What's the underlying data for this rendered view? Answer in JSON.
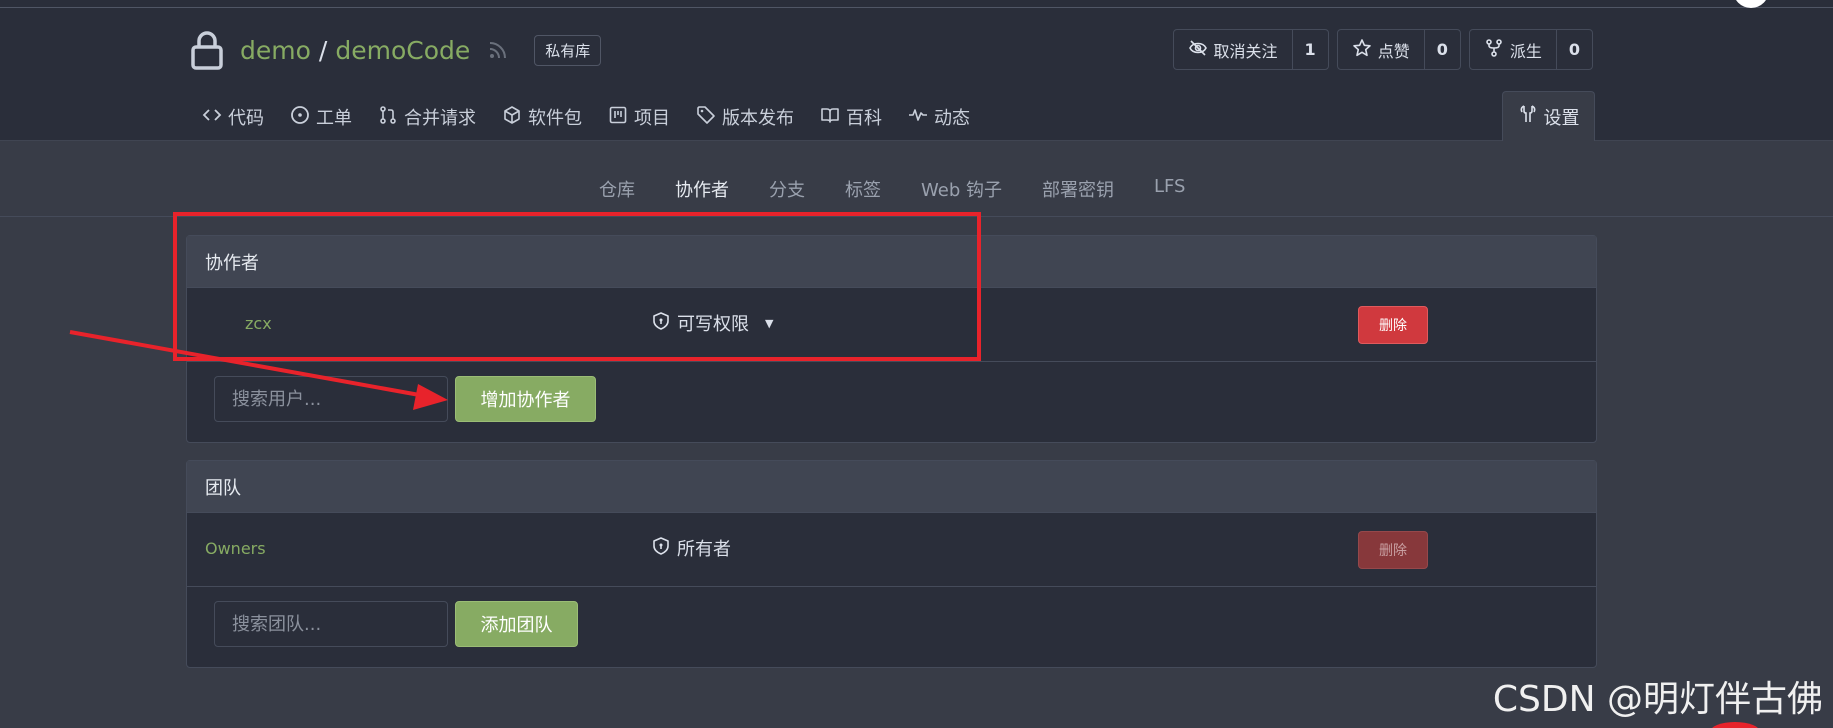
{
  "repo": {
    "owner": "demo",
    "separator": "/",
    "name": "demoCode",
    "badge": "私有库"
  },
  "buttons": {
    "watch": {
      "label": "取消关注",
      "count": "1"
    },
    "star": {
      "label": "点赞",
      "count": "0"
    },
    "fork": {
      "label": "派生",
      "count": "0"
    }
  },
  "tabs": [
    {
      "label": "代码",
      "icon": "code-icon"
    },
    {
      "label": "工单",
      "icon": "issue-icon"
    },
    {
      "label": "合并请求",
      "icon": "pull-request-icon"
    },
    {
      "label": "软件包",
      "icon": "package-icon"
    },
    {
      "label": "项目",
      "icon": "project-icon"
    },
    {
      "label": "版本发布",
      "icon": "tag-icon"
    },
    {
      "label": "百科",
      "icon": "book-icon"
    },
    {
      "label": "动态",
      "icon": "pulse-icon"
    }
  ],
  "settings_tab": "设置",
  "sub_nav": [
    "仓库",
    "协作者",
    "分支",
    "标签",
    "Web 钩子",
    "部署密钥",
    "LFS"
  ],
  "collaborators": {
    "title": "协作者",
    "rows": [
      {
        "user": "zcx",
        "permission": "可写权限",
        "delete": "删除"
      }
    ],
    "search_placeholder": "搜索用户...",
    "add_button": "增加协作者"
  },
  "teams": {
    "title": "团队",
    "rows": [
      {
        "team": "Owners",
        "permission": "所有者",
        "delete": "删除"
      }
    ],
    "search_placeholder": "搜索团队...",
    "add_button": "添加团队"
  },
  "watermark": "CSDN @明灯伴古佛",
  "colors": {
    "accent_green": "#87ab63",
    "danger_red": "#d0393e",
    "annotation_red": "#e8232b",
    "background": "#383c47",
    "header_bg": "#2a2e3a"
  }
}
